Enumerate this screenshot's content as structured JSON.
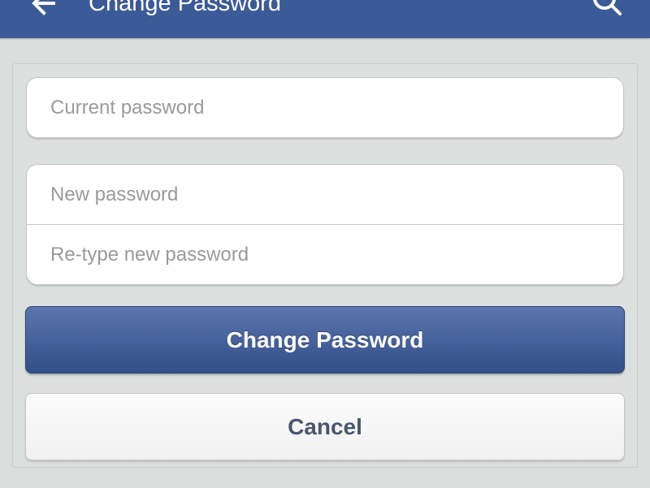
{
  "app_bar": {
    "title": "Change Password",
    "back_icon": "back-arrow-icon",
    "search_icon": "search-icon",
    "background_color": "#3b5a98"
  },
  "form": {
    "current_password": {
      "placeholder": "Current password",
      "value": ""
    },
    "new_password": {
      "placeholder": "New password",
      "value": ""
    },
    "retype_password": {
      "placeholder": "Re-type new password",
      "value": ""
    },
    "submit_label": "Change Password",
    "cancel_label": "Cancel"
  },
  "colors": {
    "primary_button": "#46629c",
    "cancel_text": "#4a5670",
    "page_background": "#dadedd"
  }
}
